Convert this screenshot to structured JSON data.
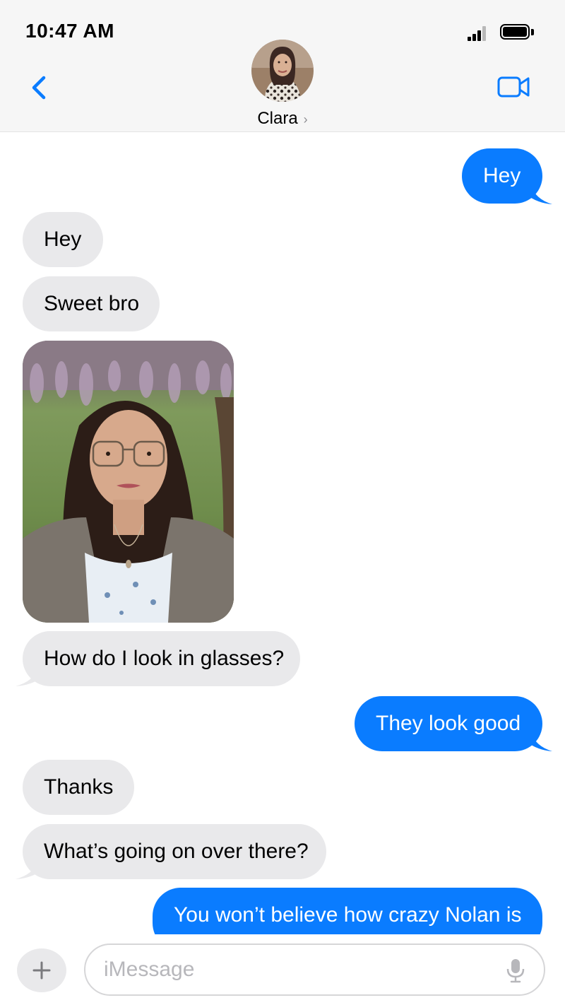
{
  "status_bar": {
    "time": "10:47 AM"
  },
  "header": {
    "contact_name": "Clara",
    "contact_chevron": "›"
  },
  "messages": [
    {
      "from": "me",
      "text": "Hey"
    },
    {
      "from": "them",
      "text": "Hey"
    },
    {
      "from": "them",
      "text": "Sweet bro"
    },
    {
      "from": "them",
      "type": "photo"
    },
    {
      "from": "them",
      "text": "How do I look in glasses?"
    },
    {
      "from": "me",
      "text": "They look good"
    },
    {
      "from": "them",
      "text": "Thanks"
    },
    {
      "from": "them",
      "text": "What’s going on over there?"
    },
    {
      "from": "me",
      "text": "You won’t believe how crazy Nolan is"
    }
  ],
  "composer": {
    "placeholder": "iMessage"
  },
  "colors": {
    "sent_bubble": "#0a7cff",
    "received_bubble": "#e9e9eb",
    "accent": "#0a7cff"
  },
  "icons": [
    "back-chevron-icon",
    "video-camera-icon",
    "plus-icon",
    "microphone-icon",
    "signal-icon",
    "battery-icon"
  ]
}
